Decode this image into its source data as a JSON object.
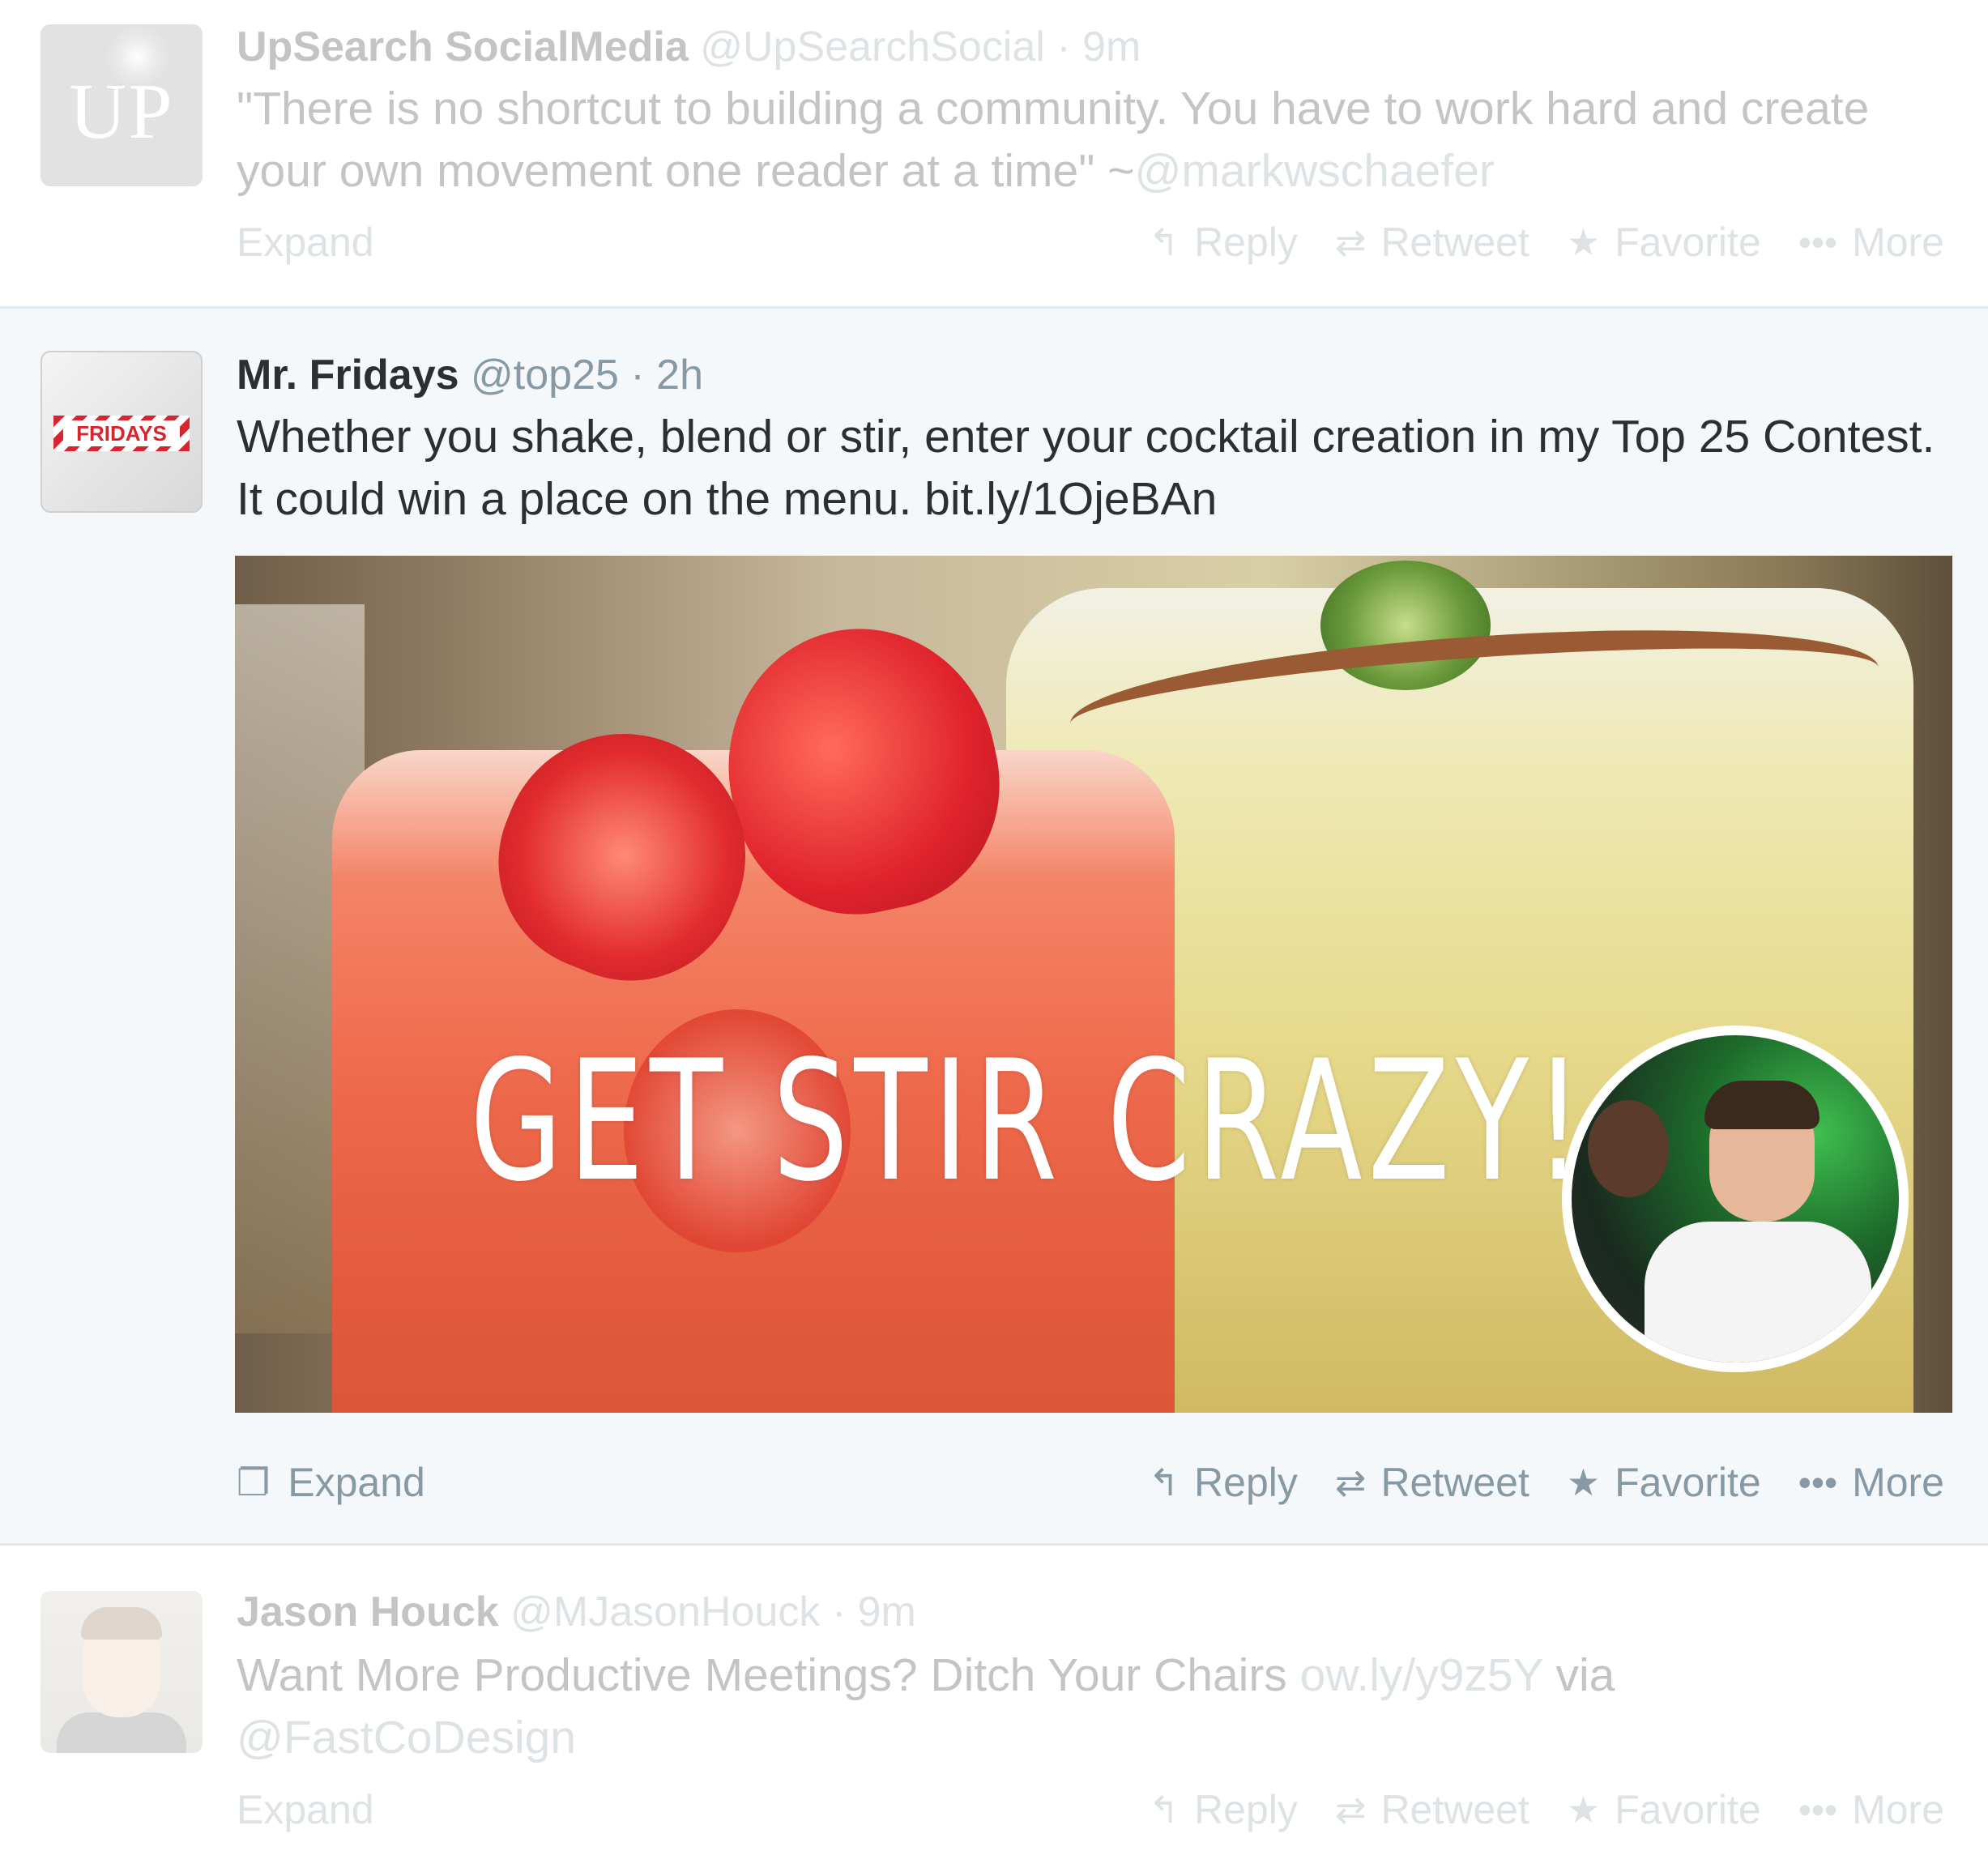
{
  "tweets": [
    {
      "name": "UpSearch SocialMedia",
      "handle": "@UpSearchSocial",
      "separator": "·",
      "time": "9m",
      "avatar_letters": "UP",
      "text_main": "\"There is no shortcut to building a community. You have to work hard and create your own movement one reader at a time\" ~",
      "text_mention": "@markwschaefer",
      "actions": {
        "expand": "Expand",
        "reply": "Reply",
        "retweet": "Retweet",
        "favorite": "Favorite",
        "more": "More"
      },
      "icons": {
        "reply": "reply-icon",
        "retweet": "retweet-icon",
        "favorite": "star-icon",
        "more": "more-dots-icon"
      }
    },
    {
      "name": "Mr. Fridays",
      "handle": "@top25",
      "separator": "·",
      "time": "2h",
      "avatar_logo_text": "FRIDAYS",
      "text": "Whether you shake, blend or stir, enter your cocktail creation in my Top 25 Contest. It could win a place on the menu. bit.ly/1OjeBAn",
      "media_headline": "GET STIR CRAZY!",
      "actions": {
        "expand": "Expand",
        "reply": "Reply",
        "retweet": "Retweet",
        "favorite": "Favorite",
        "more": "More"
      },
      "icons": {
        "expand": "media-expand-icon",
        "reply": "reply-icon",
        "retweet": "retweet-icon",
        "favorite": "star-icon",
        "more": "more-dots-icon"
      }
    },
    {
      "name": "Jason Houck",
      "handle": "@MJasonHouck",
      "separator": "·",
      "time": "9m",
      "text_main": "Want More Productive Meetings? Ditch Your Chairs",
      "text_link": "ow.ly/y9z5Y",
      "text_via": "via",
      "text_mention": "@FastCoDesign",
      "actions": {
        "expand": "Expand",
        "reply": "Reply",
        "retweet": "Retweet",
        "favorite": "Favorite",
        "more": "More"
      },
      "icons": {
        "reply": "reply-icon",
        "retweet": "retweet-icon",
        "favorite": "star-icon",
        "more": "more-dots-icon"
      }
    }
  ],
  "colors": {
    "text_primary": "#292f33",
    "text_secondary": "#8899a6",
    "highlight_bg": "#f5f8fa",
    "divider": "#e1e8ed",
    "fridays_red": "#d6252e"
  }
}
